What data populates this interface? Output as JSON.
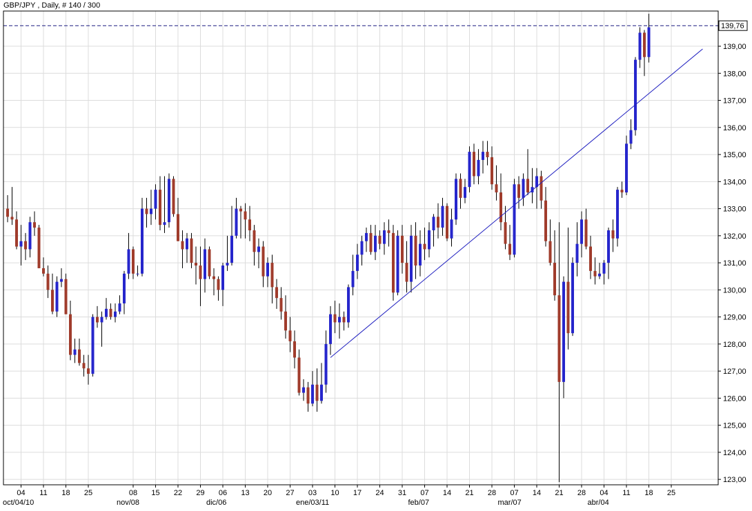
{
  "header": {
    "title": "GBP/JPY , Daily, # 140 / 300"
  },
  "colors": {
    "up": "#2626cc",
    "down": "#a03c2c",
    "grid": "#dcdcdc",
    "frame": "#000000",
    "trendline": "#2020c0",
    "price_line": "#1a1a80"
  },
  "chart_data": {
    "type": "candlestick",
    "title": "GBP/JPY , Daily, # 140 / 300",
    "ylim": [
      122.8,
      140.3
    ],
    "y_ticks": [
      123,
      124,
      125,
      126,
      127,
      128,
      129,
      130,
      131,
      132,
      133,
      134,
      135,
      136,
      137,
      138,
      139
    ],
    "y_tick_labels": [
      "123,00",
      "124,00",
      "125,00",
      "126,00",
      "127,00",
      "128,00",
      "129,00",
      "130,00",
      "131,00",
      "132,00",
      "133,00",
      "134,00",
      "135,00",
      "136,00",
      "137,00",
      "138,00",
      "139,00"
    ],
    "x_ticks": [
      {
        "day": 3,
        "label": "04"
      },
      {
        "day": 8,
        "label": "11"
      },
      {
        "day": 13,
        "label": "18"
      },
      {
        "day": 18,
        "label": "25"
      },
      {
        "day": 28,
        "label": "08"
      },
      {
        "day": 33,
        "label": "15"
      },
      {
        "day": 38,
        "label": "22"
      },
      {
        "day": 43,
        "label": "29"
      },
      {
        "day": 48,
        "label": "06"
      },
      {
        "day": 53,
        "label": "13"
      },
      {
        "day": 58,
        "label": "20"
      },
      {
        "day": 63,
        "label": "27"
      },
      {
        "day": 68,
        "label": "03"
      },
      {
        "day": 73,
        "label": "10"
      },
      {
        "day": 78,
        "label": "17"
      },
      {
        "day": 83,
        "label": "24"
      },
      {
        "day": 88,
        "label": "31"
      },
      {
        "day": 93,
        "label": "07"
      },
      {
        "day": 98,
        "label": "14"
      },
      {
        "day": 103,
        "label": "21"
      },
      {
        "day": 108,
        "label": "28"
      },
      {
        "day": 113,
        "label": "07"
      },
      {
        "day": 118,
        "label": "14"
      },
      {
        "day": 123,
        "label": "21"
      },
      {
        "day": 128,
        "label": "28"
      },
      {
        "day": 133,
        "label": "04"
      },
      {
        "day": 138,
        "label": "11"
      },
      {
        "day": 143,
        "label": "18"
      },
      {
        "day": 148,
        "label": "25"
      }
    ],
    "month_labels": [
      {
        "day": 0,
        "label": "oct/04/10"
      },
      {
        "day": 28,
        "label": "nov/08"
      },
      {
        "day": 48,
        "label": "dic/06"
      },
      {
        "day": 68,
        "label": "ene/03/11"
      },
      {
        "day": 93,
        "label": "feb/07"
      },
      {
        "day": 113,
        "label": "mar/07"
      },
      {
        "day": 133,
        "label": "abr/04"
      }
    ],
    "current_price": 139.76,
    "current_price_label": "139,76",
    "trendline": {
      "from": {
        "day": 72,
        "price": 127.5
      },
      "to": {
        "day": 155,
        "price": 138.9
      }
    },
    "ohlc": [
      [
        133.0,
        133.5,
        132.5,
        132.7
      ],
      [
        132.7,
        133.8,
        132.4,
        132.6
      ],
      [
        132.6,
        132.9,
        131.5,
        131.6
      ],
      [
        131.6,
        132.4,
        130.9,
        131.8
      ],
      [
        131.8,
        132.1,
        131.1,
        131.5
      ],
      [
        131.5,
        132.7,
        131.2,
        132.5
      ],
      [
        132.5,
        132.9,
        132.0,
        132.3
      ],
      [
        132.3,
        132.4,
        130.8,
        130.8
      ],
      [
        130.8,
        131.2,
        130.5,
        130.6
      ],
      [
        130.6,
        130.9,
        129.7,
        130.0
      ],
      [
        130.0,
        130.6,
        129.1,
        129.2
      ],
      [
        129.2,
        130.5,
        129.0,
        130.3
      ],
      [
        130.3,
        130.8,
        130.1,
        130.4
      ],
      [
        130.4,
        130.6,
        129.1,
        129.1
      ],
      [
        129.1,
        129.6,
        127.4,
        127.6
      ],
      [
        127.6,
        128.2,
        127.3,
        127.8
      ],
      [
        127.8,
        128.2,
        127.2,
        127.3
      ],
      [
        127.3,
        127.6,
        126.8,
        127.1
      ],
      [
        127.1,
        127.6,
        126.5,
        126.9
      ],
      [
        126.9,
        129.1,
        126.8,
        129.0
      ],
      [
        129.0,
        129.4,
        128.6,
        128.8
      ],
      [
        128.8,
        129.2,
        127.9,
        129.0
      ],
      [
        129.0,
        129.7,
        128.9,
        129.3
      ],
      [
        129.3,
        129.5,
        128.9,
        129.0
      ],
      [
        129.0,
        129.5,
        128.8,
        129.2
      ],
      [
        129.2,
        129.8,
        129.1,
        129.5
      ],
      [
        129.5,
        130.7,
        129.1,
        130.6
      ],
      [
        130.6,
        132.1,
        130.4,
        131.5
      ],
      [
        131.5,
        131.6,
        130.4,
        130.6
      ],
      [
        130.6,
        130.9,
        130.5,
        130.6
      ],
      [
        130.6,
        133.4,
        130.5,
        133.0
      ],
      [
        133.0,
        133.4,
        132.3,
        132.8
      ],
      [
        132.8,
        133.7,
        132.4,
        133.0
      ],
      [
        133.0,
        133.9,
        132.6,
        133.7
      ],
      [
        133.7,
        134.2,
        132.2,
        132.4
      ],
      [
        132.4,
        134.2,
        132.1,
        132.5
      ],
      [
        132.5,
        134.3,
        132.3,
        134.1
      ],
      [
        134.1,
        134.2,
        132.7,
        132.8
      ],
      [
        132.8,
        133.4,
        131.8,
        131.8
      ],
      [
        131.8,
        132.2,
        130.8,
        131.5
      ],
      [
        131.5,
        132.1,
        131.0,
        131.9
      ],
      [
        131.9,
        132.1,
        130.8,
        131.0
      ],
      [
        131.0,
        131.6,
        130.2,
        130.9
      ],
      [
        130.9,
        131.6,
        129.4,
        130.4
      ],
      [
        130.4,
        131.9,
        129.9,
        131.5
      ],
      [
        131.5,
        131.6,
        130.4,
        130.5
      ],
      [
        130.5,
        130.8,
        129.8,
        130.4
      ],
      [
        130.4,
        130.5,
        129.6,
        130.0
      ],
      [
        130.0,
        131.0,
        129.4,
        130.9
      ],
      [
        130.9,
        132.0,
        130.7,
        131.0
      ],
      [
        131.0,
        133.1,
        130.9,
        132.0
      ],
      [
        132.0,
        133.4,
        131.9,
        133.0
      ],
      [
        133.0,
        133.1,
        131.9,
        132.9
      ],
      [
        132.9,
        133.2,
        131.9,
        132.6
      ],
      [
        132.6,
        133.1,
        131.8,
        132.2
      ],
      [
        132.2,
        132.4,
        130.9,
        131.4
      ],
      [
        131.4,
        131.9,
        130.8,
        131.6
      ],
      [
        131.6,
        131.8,
        130.1,
        130.5
      ],
      [
        130.5,
        131.2,
        130.1,
        131.0
      ],
      [
        131.0,
        131.3,
        129.5,
        130.1
      ],
      [
        130.1,
        130.4,
        129.3,
        129.7
      ],
      [
        129.7,
        130.1,
        128.9,
        129.2
      ],
      [
        129.2,
        129.8,
        128.2,
        128.5
      ],
      [
        128.5,
        129.0,
        127.7,
        128.1
      ],
      [
        128.1,
        128.5,
        127.1,
        127.5
      ],
      [
        127.5,
        127.8,
        126.1,
        126.2
      ],
      [
        126.2,
        126.7,
        125.9,
        126.4
      ],
      [
        126.4,
        126.6,
        125.5,
        125.8
      ],
      [
        125.8,
        127.0,
        125.7,
        126.5
      ],
      [
        126.5,
        127.1,
        125.5,
        125.9
      ],
      [
        125.9,
        127.3,
        125.8,
        126.5
      ],
      [
        126.5,
        128.5,
        126.2,
        128.0
      ],
      [
        128.0,
        129.4,
        127.6,
        129.1
      ],
      [
        129.1,
        129.6,
        128.4,
        128.8
      ],
      [
        128.8,
        129.5,
        128.2,
        129.0
      ],
      [
        129.0,
        129.2,
        128.5,
        128.8
      ],
      [
        128.8,
        130.2,
        128.6,
        130.1
      ],
      [
        130.1,
        131.3,
        129.8,
        130.7
      ],
      [
        130.7,
        131.7,
        130.4,
        131.3
      ],
      [
        131.3,
        132.0,
        130.9,
        131.8
      ],
      [
        131.8,
        132.3,
        131.4,
        132.1
      ],
      [
        132.1,
        132.4,
        131.3,
        131.4
      ],
      [
        131.4,
        132.4,
        131.1,
        132.0
      ],
      [
        132.0,
        132.2,
        131.5,
        131.7
      ],
      [
        131.7,
        132.5,
        131.3,
        132.2
      ],
      [
        132.2,
        132.6,
        131.6,
        132.1
      ],
      [
        132.1,
        132.4,
        129.6,
        129.9
      ],
      [
        129.9,
        132.2,
        129.8,
        132.0
      ],
      [
        132.0,
        132.4,
        130.6,
        131.0
      ],
      [
        131.0,
        131.8,
        129.9,
        130.3
      ],
      [
        130.3,
        132.4,
        129.9,
        132.0
      ],
      [
        132.0,
        132.5,
        130.4,
        130.9
      ],
      [
        130.9,
        132.2,
        130.5,
        131.7
      ],
      [
        131.7,
        132.3,
        131.1,
        131.5
      ],
      [
        131.5,
        132.5,
        131.2,
        132.2
      ],
      [
        132.2,
        132.8,
        131.6,
        132.7
      ],
      [
        132.7,
        133.2,
        131.9,
        132.3
      ],
      [
        132.3,
        133.4,
        132.0,
        133.1
      ],
      [
        133.1,
        133.2,
        131.8,
        131.9
      ],
      [
        131.9,
        133.0,
        131.6,
        132.6
      ],
      [
        132.6,
        134.3,
        132.4,
        134.1
      ],
      [
        134.1,
        134.3,
        133.0,
        133.4
      ],
      [
        133.4,
        134.1,
        133.2,
        133.8
      ],
      [
        133.8,
        135.3,
        133.6,
        135.1
      ],
      [
        135.1,
        135.4,
        133.9,
        134.2
      ],
      [
        134.2,
        135.2,
        133.9,
        134.8
      ],
      [
        134.8,
        135.5,
        134.3,
        135.1
      ],
      [
        135.1,
        135.5,
        134.6,
        134.9
      ],
      [
        134.9,
        135.3,
        133.7,
        133.9
      ],
      [
        133.9,
        134.6,
        133.3,
        133.6
      ],
      [
        133.6,
        134.3,
        132.2,
        132.5
      ],
      [
        132.5,
        133.1,
        131.5,
        131.7
      ],
      [
        131.7,
        132.4,
        131.1,
        131.3
      ],
      [
        131.3,
        134.1,
        131.2,
        133.9
      ],
      [
        133.9,
        134.2,
        133.0,
        133.4
      ],
      [
        133.4,
        134.3,
        133.1,
        134.1
      ],
      [
        134.1,
        135.2,
        133.5,
        133.6
      ],
      [
        133.6,
        134.5,
        133.2,
        133.8
      ],
      [
        133.8,
        134.5,
        133.0,
        134.2
      ],
      [
        134.2,
        134.4,
        133.0,
        133.3
      ],
      [
        133.3,
        133.8,
        131.6,
        131.8
      ],
      [
        131.8,
        132.6,
        130.9,
        131.0
      ],
      [
        131.0,
        132.2,
        129.6,
        129.8
      ],
      [
        129.8,
        132.5,
        122.9,
        126.6
      ],
      [
        126.6,
        130.5,
        126.0,
        130.3
      ],
      [
        130.3,
        132.3,
        127.8,
        128.4
      ],
      [
        128.4,
        131.2,
        128.3,
        131.0
      ],
      [
        131.0,
        132.5,
        130.5,
        131.7
      ],
      [
        131.7,
        132.9,
        131.2,
        132.6
      ],
      [
        132.6,
        133.0,
        131.5,
        131.6
      ],
      [
        131.6,
        132.0,
        130.4,
        130.7
      ],
      [
        130.7,
        131.2,
        130.2,
        130.5
      ],
      [
        130.5,
        131.0,
        130.4,
        130.6
      ],
      [
        130.6,
        131.1,
        130.2,
        131.0
      ],
      [
        131.0,
        132.3,
        130.4,
        132.2
      ],
      [
        132.2,
        132.6,
        131.4,
        131.9
      ],
      [
        131.9,
        133.8,
        131.6,
        133.7
      ],
      [
        133.7,
        134.0,
        133.4,
        133.6
      ],
      [
        133.6,
        135.7,
        133.5,
        135.4
      ],
      [
        135.4,
        136.3,
        135.2,
        135.9
      ],
      [
        135.9,
        138.6,
        135.7,
        138.5
      ],
      [
        138.5,
        139.7,
        138.2,
        139.5
      ],
      [
        139.5,
        139.6,
        137.9,
        138.6
      ],
      [
        138.6,
        140.2,
        138.4,
        139.7
      ]
    ]
  }
}
